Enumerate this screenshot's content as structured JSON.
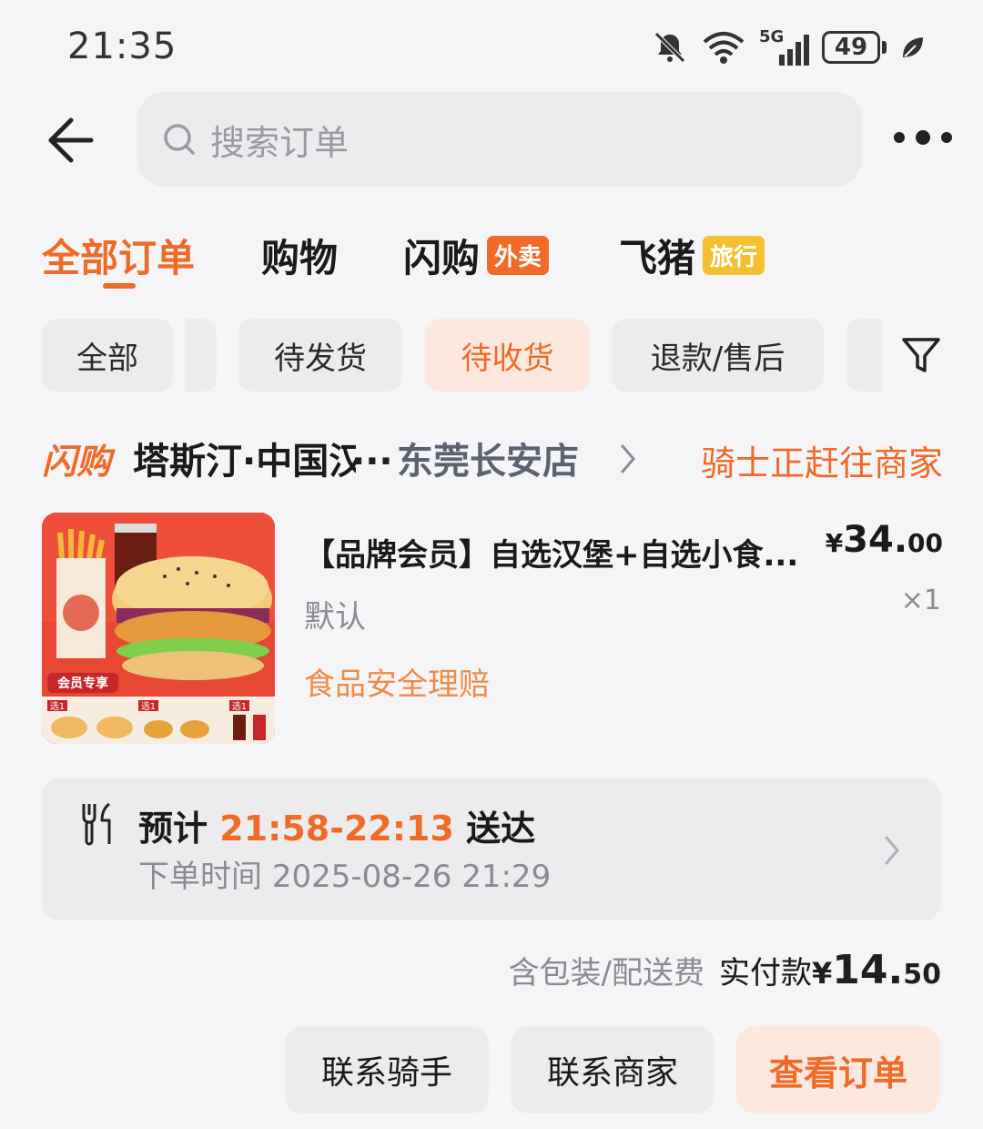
{
  "status_bar": {
    "time": "21:35",
    "battery": "49",
    "network": "5G"
  },
  "search": {
    "placeholder": "搜索订单"
  },
  "tabs": [
    {
      "label": "全部订单",
      "badge": ""
    },
    {
      "label": "购物",
      "badge": ""
    },
    {
      "label": "闪购",
      "badge": "外卖"
    },
    {
      "label": "飞猪",
      "badge": "旅行"
    }
  ],
  "filters": [
    "全部",
    "待发货",
    "待收货",
    "退款/售后"
  ],
  "order": {
    "platform_logo": "闪购",
    "store_name": "塔斯汀·中国汉堡",
    "store_ellipsis": "...",
    "store_branch": "东莞长安店",
    "status": "骑士正赶往商家",
    "product_badge": "会员专享",
    "product_pick": [
      "选1",
      "选1",
      "选1"
    ],
    "product_title": "【品牌会员】自选汉堡+自选小食...",
    "price": {
      "currency": "¥",
      "integer": "34.",
      "decimal": "00"
    },
    "spec": "默认",
    "quantity": "×1",
    "claim": "食品安全理赔",
    "eta_prefix": "预计",
    "eta_time": "21:58-22:13",
    "eta_suffix": "送达",
    "order_time_label": "下单时间",
    "order_time": "2025-08-26 21:29",
    "fee_note": "含包装/配送费",
    "paid_label": "实付款",
    "paid": {
      "currency": "¥",
      "integer": "14.",
      "decimal": "50"
    }
  },
  "actions": {
    "contact_rider": "联系骑手",
    "contact_store": "联系商家",
    "view_order": "查看订单"
  },
  "colors": {
    "accent": "#f06a28",
    "badge_yellow": "#f5c02f",
    "chip_active_bg": "#fde8df"
  }
}
